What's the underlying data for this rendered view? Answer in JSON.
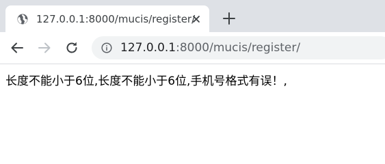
{
  "tab": {
    "title": "127.0.0.1:8000/mucis/register/",
    "favicon": "globe-icon"
  },
  "toolbar": {
    "back_icon": "back-arrow-icon",
    "forward_icon": "forward-arrow-icon",
    "reload_icon": "reload-icon",
    "url_host": "127.0.0.1",
    "url_rest": ":8000/mucis/register/",
    "site_info_icon": "info-icon"
  },
  "page": {
    "message": "长度不能小于6位,长度不能小于6位,手机号格式有误！,"
  },
  "colors": {
    "tabstrip": "#dee1e6",
    "omnibox": "#f1f3f4",
    "text": "#202124",
    "muted": "#5f6368"
  }
}
